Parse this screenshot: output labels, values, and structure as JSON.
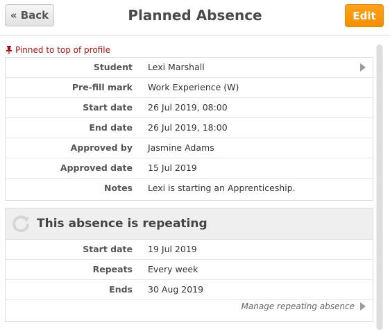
{
  "header": {
    "back_label": "« Back",
    "title": "Planned Absence",
    "edit_label": "Edit"
  },
  "pinned": {
    "text": "Pinned to top of profile"
  },
  "details": [
    {
      "label": "Student",
      "value": "Lexi Marshall"
    },
    {
      "label": "Pre-fill mark",
      "value": "Work Experience (W)"
    },
    {
      "label": "Start date",
      "value": "26 Jul 2019, 08:00"
    },
    {
      "label": "End date",
      "value": "26 Jul 2019, 18:00"
    },
    {
      "label": "Approved by",
      "value": "Jasmine Adams"
    },
    {
      "label": "Approved date",
      "value": "15 Jul 2019"
    },
    {
      "label": "Notes",
      "value": "Lexi is starting an Apprenticeship."
    }
  ],
  "repeating": {
    "title": "This absence is repeating",
    "rows": [
      {
        "label": "Start date",
        "value": "19 Jul 2019"
      },
      {
        "label": "Repeats",
        "value": "Every week"
      },
      {
        "label": "Ends",
        "value": "30 Aug 2019"
      }
    ],
    "manage_label": "Manage repeating absence"
  },
  "colors": {
    "edit_button": "#f7950f",
    "pinned_text": "#b40f0f"
  }
}
